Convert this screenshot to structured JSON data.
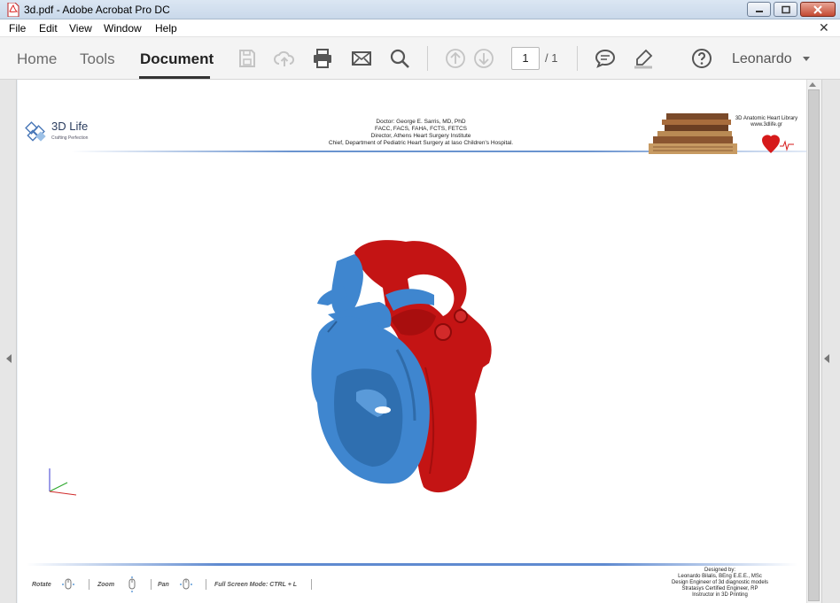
{
  "window": {
    "title": "3d.pdf - Adobe Acrobat Pro DC"
  },
  "menu": {
    "items": [
      "File",
      "Edit",
      "View",
      "Window",
      "Help"
    ]
  },
  "toolbar": {
    "tabs": [
      "Home",
      "Tools",
      "Document"
    ],
    "active_tab": "Document",
    "icons": [
      "save-icon",
      "upload-icon",
      "print-icon",
      "email-icon",
      "search-icon",
      "previous-page-icon",
      "next-page-icon",
      "comment-icon",
      "highlight-pen-icon",
      "help-icon"
    ],
    "page_current": "1",
    "page_total": "/ 1",
    "user": "Leonardo"
  },
  "document": {
    "logo": {
      "name": "3D Life",
      "tagline": "Crafting Perfection"
    },
    "header_lines": [
      "Doctor: George E. Sarris, MD, PhD",
      "FACC, FACS, FAHA, FCTS, FETCS",
      "Director, Athens Heart Surgery Institute",
      "Chief, Department of Pediatric Heart Surgery at Iaso Children's Hospital."
    ],
    "library": {
      "title": "3D Anatomic Heart Library",
      "url": "www.3dlife.gr"
    },
    "controls": [
      {
        "label": "Rotate",
        "icon": "rotate-mouse-icon"
      },
      {
        "label": "Zoom",
        "icon": "zoom-mouse-icon"
      },
      {
        "label": "Pan",
        "icon": "pan-mouse-icon"
      }
    ],
    "fullscreen": "Full Screen Mode:  CTRL + L",
    "credits": [
      "Designed by:",
      "Leonardo Bilalis, BEng E.E.E., MSc",
      "Design Engineer of 3d diagnostic models",
      "Stratasys Certified Engineer, RP",
      "Instructor in 3D Printing"
    ]
  },
  "colors": {
    "accent_blue": "#5f8ad0",
    "heart_blue": "#3f86cf",
    "heart_red": "#c41414"
  }
}
